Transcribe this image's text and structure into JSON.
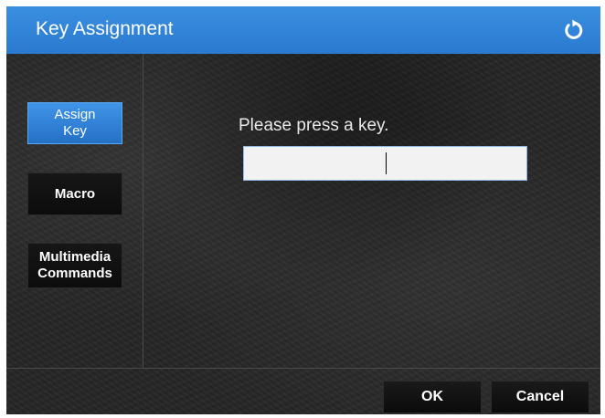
{
  "dialog": {
    "title": "Key Assignment",
    "reset_icon": "refresh-icon",
    "accent_color": "#2f86dc"
  },
  "sidebar": {
    "items": [
      {
        "label": "Assign Key",
        "active": true
      },
      {
        "label": "Macro",
        "active": false
      },
      {
        "label": "Multimedia Commands",
        "active": false
      }
    ]
  },
  "main": {
    "prompt": "Please press a key.",
    "key_field_value": ""
  },
  "footer": {
    "ok_label": "OK",
    "cancel_label": "Cancel"
  }
}
